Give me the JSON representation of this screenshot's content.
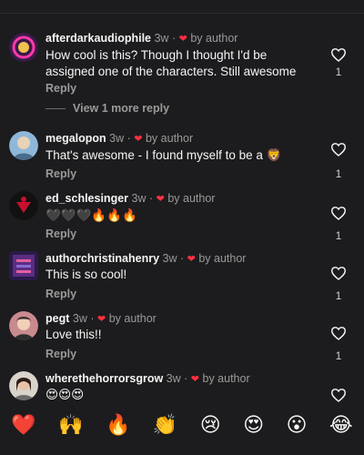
{
  "comments": [
    {
      "username": "afterdarkaudiophile",
      "time": "3w",
      "author_tag": "by author",
      "text_line1": "How cool is this? Though I thought I'd be",
      "text_line2": "assigned one of the characters. Still awesome",
      "reply_label": "Reply",
      "likes": "1",
      "view_more": "View 1 more reply"
    },
    {
      "username": "megalopon",
      "time": "3w",
      "author_tag": "by author",
      "text": "That's awesome - I found myself to be a",
      "text_emoji": "🦁",
      "reply_label": "Reply",
      "likes": "1"
    },
    {
      "username": "ed_schlesinger",
      "time": "3w",
      "author_tag": "by author",
      "text": "🖤🖤🖤🔥🔥🔥",
      "reply_label": "Reply",
      "likes": "1"
    },
    {
      "username": "authorchristinahenry",
      "time": "3w",
      "author_tag": "by author",
      "text": "This is so cool!",
      "reply_label": "Reply",
      "likes": "1"
    },
    {
      "username": "pegt",
      "time": "3w",
      "author_tag": "by author",
      "text": "Love this!!",
      "reply_label": "Reply",
      "likes": "1"
    },
    {
      "username": "wherethehorrorsgrow",
      "time": "3w",
      "author_tag": "by author",
      "text": "😍😍😍"
    }
  ],
  "reactions": [
    "❤️",
    "🙌",
    "🔥",
    "👏",
    "😢",
    "😍",
    "😮",
    "😂"
  ],
  "colors": {
    "background": "#1c1c1e",
    "heart": "#ff3040",
    "muted": "#9a9a9a"
  },
  "icons": {
    "like": "heart-outline-icon",
    "author_like": "heart-filled-icon"
  }
}
